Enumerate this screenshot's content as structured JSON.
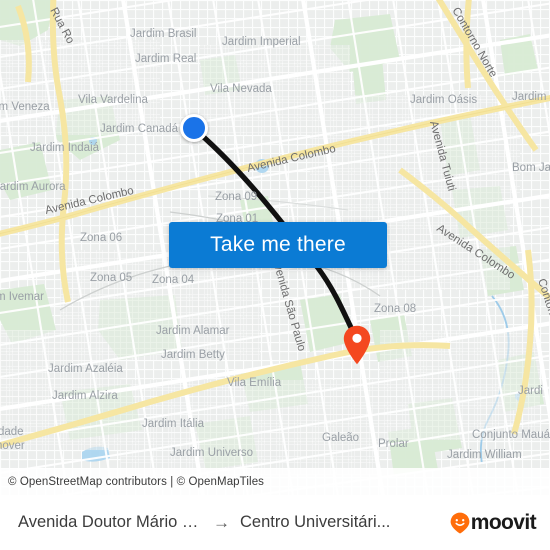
{
  "map": {
    "attribution": "© OpenStreetMap contributors | © OpenMapTiles",
    "colors": {
      "land": "#eef0ef",
      "road_minor": "#ffffff",
      "road_major": "#f7e9a0",
      "park": "#d6ecd2",
      "water": "#a9d4f0",
      "route_line": "#111111",
      "origin": "#1a73e8",
      "destination": "#f4481f",
      "label": "#9aa0a6"
    },
    "neighborhood_labels": [
      "Jardim Brasil",
      "Jardim Imperial",
      "Jardim Real",
      "Vila Nevada",
      "Jardim Oásis",
      "Jardim I",
      "Vila Vardelina",
      "Jardim Canadá",
      "Jardim Indaiá",
      "im Veneza",
      "Bom Ja",
      "Jardim Aurora",
      "Zona 09",
      "Zona 01",
      "Zona 06",
      "Zona 05",
      "Zona 04",
      "m Ivemar",
      "Zona 08",
      "Jardim Alamar",
      "Jardim Betty",
      "Jardim Azaléia",
      "Vila Emília",
      "Jardim Alzira",
      "Jardim Itália",
      "Jardim Universo",
      "Galeão",
      "Prolar",
      "Conjunto Mauá",
      "Jardim William",
      "Jardi",
      "dade",
      "nover"
    ],
    "road_labels": [
      "Rua Ro",
      "Contorno Norte",
      "Avenida Colombo",
      "Avenida Tuiuti",
      "Avenida São Paulo",
      "Contorno"
    ]
  },
  "button": {
    "take_me_there_label": "Take me there"
  },
  "markers": {
    "origin_name": "origin-marker",
    "destination_name": "destination-marker"
  },
  "bottom_bar": {
    "origin": "Avenida Doutor Mário Clapier...",
    "arrow": "→",
    "destination": "Centro Universitári...",
    "brand": "moovit"
  }
}
